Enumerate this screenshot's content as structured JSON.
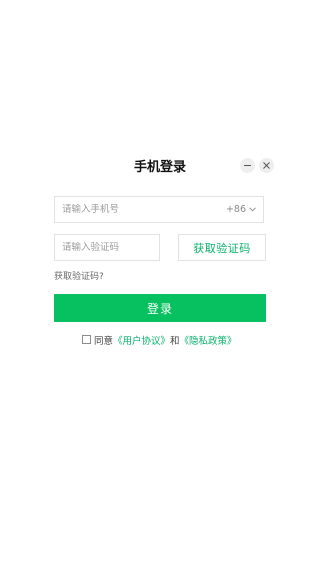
{
  "dialog": {
    "title": "手机登录",
    "phone": {
      "placeholder": "请输入手机号",
      "country_code": "+86"
    },
    "code": {
      "placeholder": "请输入验证码"
    },
    "get_code_label": "获取验证码",
    "help_text": "获取验证码?",
    "login_label": "登录",
    "agreement": {
      "prefix": "同意",
      "user_agreement": "《用户协议》",
      "joiner": "和",
      "privacy_policy": "《隐私政策》",
      "checked": false
    }
  },
  "colors": {
    "accent": "#07c160",
    "link": "#07b16a",
    "border": "#e2e2e2",
    "window_button_bg": "#eeeeee"
  },
  "icons": {
    "minimize": "minimize-icon",
    "close": "close-icon",
    "country_dropdown": "chevron-down-icon"
  }
}
